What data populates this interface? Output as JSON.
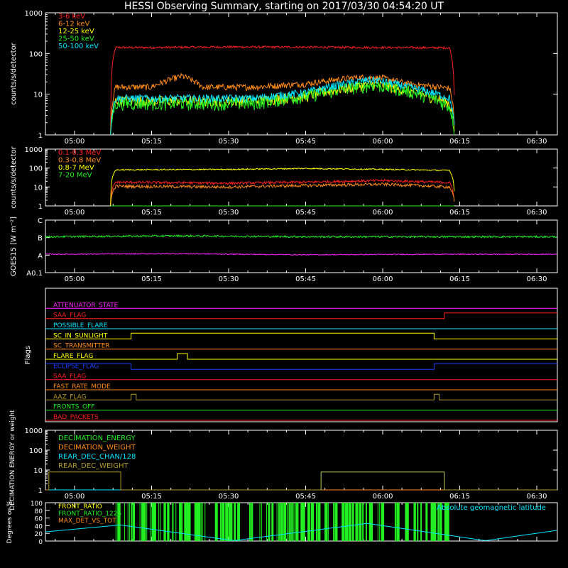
{
  "title": "HESSI Observing Summary, starting on 2017/03/30 04:54:20 UT",
  "colors": {
    "background": "#000000",
    "axes": "#ffffff",
    "red": "#ff2020",
    "orange": "#ff8c1a",
    "yellow": "#ffff00",
    "green": "#22ee22",
    "cyan": "#00e5ff",
    "magenta": "#ff22ff",
    "blue": "#1f3fff",
    "olive": "#b39a2a",
    "light_green": "#33ff33"
  },
  "time_axis": {
    "start": "04:54:20",
    "end": "06:34:00",
    "tick_labels": [
      "05:00",
      "05:15",
      "05:30",
      "05:45",
      "06:00",
      "06:15",
      "06:30"
    ],
    "minor_ticks_per_major": 3
  },
  "chart_data": [
    {
      "type": "line",
      "id": "xray",
      "ylabel": "counts/s/detector",
      "yscale": "log",
      "ylim": [
        1,
        1000
      ],
      "ytick_labels": [
        "1",
        "10",
        "100",
        "1000"
      ],
      "legend_placement": "top-left",
      "series": [
        {
          "name": "3-6 keV",
          "color": "#ff2020",
          "x": [
            "05:07",
            "05:08",
            "05:15",
            "05:30",
            "05:45",
            "06:00",
            "06:13",
            "06:14"
          ],
          "y": [
            1,
            140,
            140,
            145,
            143,
            140,
            138,
            1
          ]
        },
        {
          "name": "6-12 keV",
          "color": "#ff8c1a",
          "x": [
            "05:07",
            "05:08",
            "05:15",
            "05:21",
            "05:25",
            "05:35",
            "05:45",
            "05:55",
            "06:00",
            "06:05",
            "06:13",
            "06:14"
          ],
          "y": [
            1,
            15,
            15,
            28,
            15,
            15,
            18,
            26,
            25,
            18,
            14,
            1
          ]
        },
        {
          "name": "12-25 keV",
          "color": "#ffff00",
          "x": [
            "05:07",
            "05:08",
            "05:20",
            "05:35",
            "05:45",
            "05:58",
            "06:05",
            "06:13",
            "06:14"
          ],
          "y": [
            1,
            7,
            7,
            7,
            9,
            18,
            12,
            6,
            1
          ]
        },
        {
          "name": "25-50 keV",
          "color": "#22ee22",
          "x": [
            "05:07",
            "05:08",
            "05:20",
            "05:35",
            "05:45",
            "05:58",
            "06:05",
            "06:13",
            "06:14"
          ],
          "y": [
            1,
            6,
            6,
            6,
            9,
            17,
            12,
            5,
            1
          ]
        },
        {
          "name": "50-100 keV",
          "color": "#00e5ff",
          "x": [
            "05:07",
            "05:08",
            "05:20",
            "05:35",
            "05:45",
            "05:58",
            "06:05",
            "06:13",
            "06:14"
          ],
          "y": [
            1,
            8,
            8,
            8,
            11,
            23,
            15,
            8,
            1
          ]
        }
      ]
    },
    {
      "type": "line",
      "id": "gamma",
      "ylabel": "counts/s/detector",
      "yscale": "log",
      "ylim": [
        1,
        1000
      ],
      "ytick_labels": [
        "1",
        "10",
        "100",
        "1000"
      ],
      "legend_placement": "top-left",
      "series": [
        {
          "name": "0.1-0.3 MeV",
          "color": "#ff2020",
          "x": [
            "05:07",
            "05:08",
            "05:30",
            "05:45",
            "06:00",
            "06:13",
            "06:14"
          ],
          "y": [
            1,
            18,
            16,
            18,
            22,
            17,
            1
          ]
        },
        {
          "name": "0.3-0.8 MeV",
          "color": "#ff8c1a",
          "x": [
            "05:07",
            "05:08",
            "05:30",
            "05:45",
            "06:00",
            "06:13",
            "06:14"
          ],
          "y": [
            1,
            11,
            10,
            12,
            14,
            10,
            1
          ]
        },
        {
          "name": "0.8-7 MeV",
          "color": "#ffff00",
          "x": [
            "05:07",
            "05:08",
            "05:30",
            "05:45",
            "06:00",
            "06:13",
            "06:14"
          ],
          "y": [
            1,
            80,
            85,
            95,
            85,
            75,
            1
          ]
        },
        {
          "name": "7-20 MeV",
          "color": "#22ee22",
          "x": [
            "05:07",
            "05:08",
            "06:13",
            "06:14"
          ],
          "y": [
            1,
            1,
            1,
            1
          ]
        }
      ]
    },
    {
      "type": "line",
      "id": "goes",
      "ylabel": "GOES15 [W m⁻²]",
      "ylim": [
        0,
        3
      ],
      "ytick_labels": [
        "A0.1",
        "A",
        "B",
        "C"
      ],
      "series": [
        {
          "name": "",
          "color": "#22ee22",
          "x": [
            "04:54:20",
            "05:20",
            "05:45",
            "06:10",
            "06:34"
          ],
          "y": [
            2.05,
            2.1,
            2.05,
            2.05,
            2.05
          ]
        },
        {
          "name": "",
          "color": "#ff22ff",
          "x": [
            "04:54:20",
            "05:20",
            "05:45",
            "06:10",
            "06:34"
          ],
          "y": [
            1.05,
            1.08,
            1.02,
            1.05,
            1.05
          ]
        }
      ]
    },
    {
      "type": "line",
      "id": "flags",
      "ylabel": "Flags",
      "series": [
        {
          "name": "ATTENUATOR_STATE",
          "color": "#ff22ff",
          "x": [
            "04:54:20",
            "06:34"
          ],
          "y": [
            0,
            0
          ]
        },
        {
          "name": "SAA_FLAG",
          "color": "#ff2020",
          "x": [
            "04:54:20",
            "06:12",
            "06:12",
            "06:34"
          ],
          "y": [
            0,
            0,
            1,
            1
          ]
        },
        {
          "name": "POSSIBLE_FLARE",
          "color": "#00e5ff",
          "x": [
            "04:54:20",
            "06:34"
          ],
          "y": [
            0,
            0
          ]
        },
        {
          "name": "SC_IN_SUNLIGHT",
          "color": "#ffff00",
          "x": [
            "04:54:20",
            "05:11",
            "05:11",
            "06:10",
            "06:10",
            "06:34"
          ],
          "y": [
            0,
            0,
            1,
            1,
            0,
            0
          ]
        },
        {
          "name": "SC_TRANSMITTER",
          "color": "#ff8c1a",
          "x": [
            "04:54:20",
            "06:34"
          ],
          "y": [
            0,
            0
          ]
        },
        {
          "name": "FLARE_FLAG",
          "color": "#ffff00",
          "x": [
            "04:54:20",
            "05:20",
            "05:20",
            "05:22",
            "05:22",
            "06:34"
          ],
          "y": [
            0,
            0,
            1,
            1,
            0,
            0
          ]
        },
        {
          "name": "ECLIPSE_FLAG",
          "color": "#1f3fff",
          "x": [
            "04:54:20",
            "05:11",
            "05:11",
            "06:10",
            "06:10",
            "06:34"
          ],
          "y": [
            1,
            1,
            0,
            0,
            1,
            1
          ]
        },
        {
          "name": "SAA_FLAG",
          "color": "#ff2020",
          "x": [
            "04:54:20",
            "06:34"
          ],
          "y": [
            0,
            0
          ]
        },
        {
          "name": "FAST_RATE_MODE",
          "color": "#ff8c1a",
          "x": [
            "04:54:20",
            "06:34"
          ],
          "y": [
            0,
            0
          ]
        },
        {
          "name": "AAZ_FLAG",
          "color": "#b39a2a",
          "x": [
            "04:54:20",
            "05:11",
            "05:11",
            "05:12",
            "05:12",
            "06:10",
            "06:10",
            "06:11",
            "06:11",
            "06:34"
          ],
          "y": [
            0,
            0,
            1,
            1,
            0,
            0,
            1,
            1,
            0,
            0
          ]
        },
        {
          "name": "FRONTS_OFF",
          "color": "#22ee22",
          "x": [
            "04:54:20",
            "06:34"
          ],
          "y": [
            0,
            0
          ]
        },
        {
          "name": "BAD_PACKETS",
          "color": "#ff2020",
          "x": [
            "04:54:20",
            "06:34"
          ],
          "y": [
            0,
            0
          ]
        }
      ]
    },
    {
      "type": "line",
      "id": "decimation",
      "ylabel": "DECIMATION ENERGY or weight",
      "yscale": "log",
      "ylim": [
        1,
        1000
      ],
      "ytick_labels": [
        "1",
        "10",
        "100",
        "1000"
      ],
      "legend_placement": "top-left",
      "series": [
        {
          "name": "DECIMATION_ENERGY",
          "color": "#22ee22",
          "x": [
            "04:54:20",
            "06:34"
          ],
          "y": [
            1,
            1
          ]
        },
        {
          "name": "DECIMATION_WEIGHT",
          "color": "#ff8c1a",
          "x": [
            "04:54:20",
            "06:34"
          ],
          "y": [
            1,
            1
          ]
        },
        {
          "name": "REAR_DEC_CHAN/128",
          "color": "#00e5ff",
          "x": [
            "04:54:20",
            "05:48",
            "05:48",
            "06:12",
            "06:12",
            "06:34"
          ],
          "y": [
            1,
            1,
            8,
            8,
            1,
            1
          ]
        },
        {
          "name": "REAR_DEC_WEIGHT",
          "color": "#b39a2a",
          "x": [
            "04:54:20",
            "04:55",
            "04:55",
            "05:09",
            "05:09",
            "05:48",
            "05:48",
            "06:12",
            "06:12",
            "06:34"
          ],
          "y": [
            1,
            1,
            8,
            8,
            1,
            1,
            8,
            8,
            1,
            1
          ]
        }
      ]
    },
    {
      "type": "line",
      "id": "ratio",
      "ylabel": "Degrees or %",
      "ylim": [
        0,
        100
      ],
      "ytick_labels": [
        "0",
        "20",
        "40",
        "60",
        "80",
        "100"
      ],
      "legend_placement": "top-left",
      "annotation": "Absolute geomagnetic latitude",
      "series": [
        {
          "name": "FRONT_RATIO",
          "color": "#ffff00",
          "x": [],
          "y": []
        },
        {
          "name": "FRONT_RATIO_1225",
          "color": "#22ee22",
          "x": [
            "05:08",
            "06:13"
          ],
          "y": [
            100,
            100
          ]
        },
        {
          "name": "MAX_DET_VS_TOT",
          "color": "#ff8c1a",
          "x": [],
          "y": []
        },
        {
          "name": "Absolute geomagnetic latitude",
          "color": "#00e5ff",
          "x": [
            "04:54:20",
            "05:09",
            "05:31",
            "05:57",
            "06:20",
            "06:34"
          ],
          "y": [
            24,
            42,
            1,
            46,
            1,
            28
          ]
        }
      ]
    }
  ],
  "flag_labels": [
    "ATTENUATOR_STATE",
    "SAA_FLAG",
    "POSSIBLE_FLARE",
    "SC_IN_SUNLIGHT",
    "SC_TRANSMITTER",
    "FLARE_FLAG",
    "ECLIPSE_FLAG",
    "SAA_FLAG",
    "FAST_RATE_MODE",
    "AAZ_FLAG",
    "FRONTS_OFF",
    "BAD_PACKETS"
  ]
}
